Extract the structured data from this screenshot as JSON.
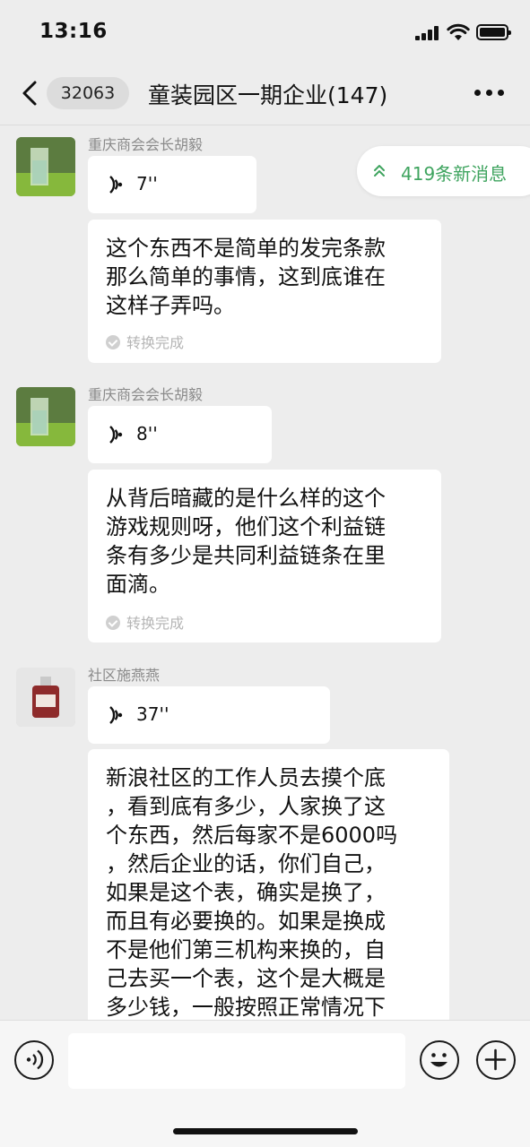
{
  "status_bar": {
    "time": "13:16"
  },
  "nav": {
    "unread_count": "32063",
    "title": "童装园区一期企业(147)"
  },
  "new_messages_badge": "419条新消息",
  "messages": [
    {
      "sender": "重庆商会会长胡毅",
      "voice_duration": "7''",
      "transcript": "这个东西不是简单的发完条款\n那么简单的事情，这到底谁在\n这样子弄吗。",
      "status": "转换完成"
    },
    {
      "sender": "重庆商会会长胡毅",
      "voice_duration": "8''",
      "transcript": "从背后暗藏的是什么样的这个\n游戏规则呀，他们这个利益链\n条有多少是共同利益链条在里\n面滴。",
      "status": "转换完成"
    },
    {
      "sender": "社区施燕燕",
      "voice_duration": "37''",
      "transcript": "新浪社区的工作人员去摸个底\n，看到底有多少，人家换了这\n个东西，然后每家不是6000吗\n，然后企业的话，你们自己，\n如果是这个表，确实是换了，\n而且有必要换的。如果是换成\n不是他们第三机构来换的，自\n己去买一个表，这个是大概是\n多少钱，一般按照正常情况下"
    }
  ],
  "input_bar": {
    "placeholder": ""
  },
  "icons": {
    "back": "chevron-left-icon",
    "more": "more-dots-icon",
    "voice": "voice-wave-icon",
    "check": "check-circle-icon",
    "up": "double-chevron-up-icon",
    "emoji": "smiley-icon",
    "plus": "plus-circle-icon"
  },
  "colors": {
    "background": "#ededed",
    "bubble": "#ffffff",
    "badge_text": "#3fa45f",
    "secondary_text": "#8a8a8a"
  }
}
